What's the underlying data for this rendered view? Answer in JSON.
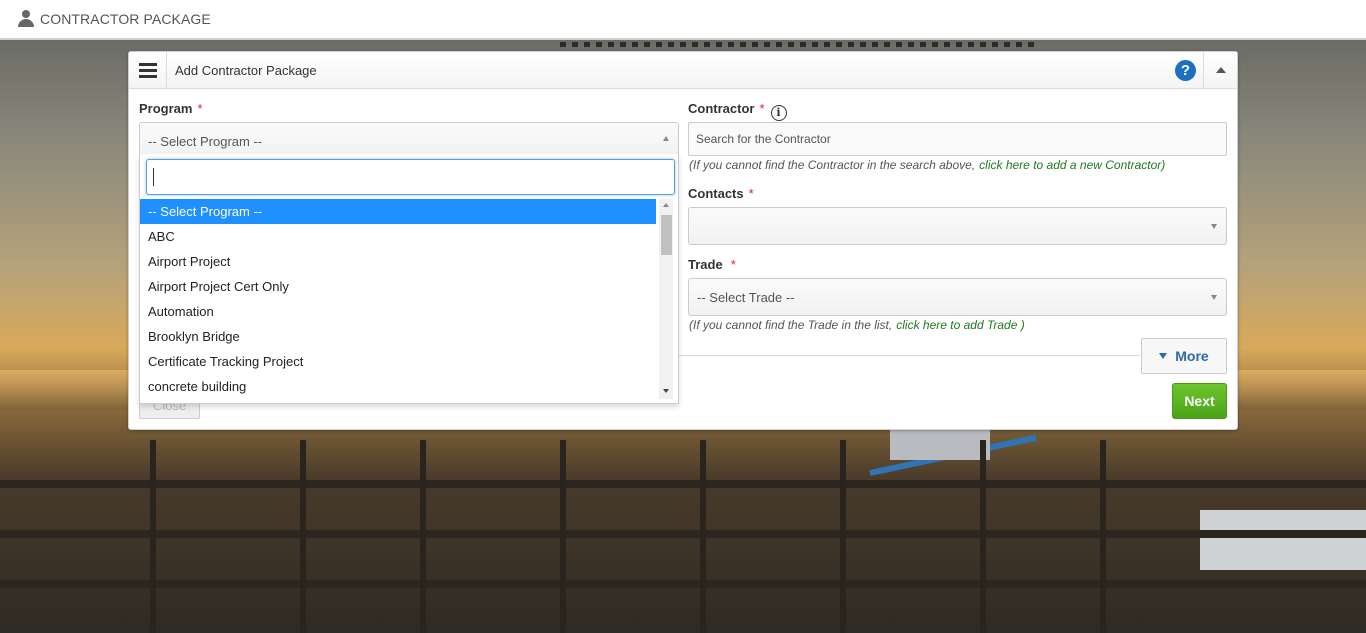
{
  "header": {
    "title": "CONTRACTOR PACKAGE"
  },
  "panel": {
    "title": "Add Contractor Package",
    "help_glyph": "?"
  },
  "program": {
    "label": "Program",
    "required_mark": "*",
    "selected": "-- Select Program --",
    "search_value": "",
    "options": [
      "-- Select Program --",
      "ABC",
      "Airport Project",
      "Airport Project Cert Only",
      "Automation",
      "Brooklyn Bridge",
      "Certificate Tracking Project",
      "concrete building"
    ],
    "highlighted_index": 0
  },
  "contractor": {
    "label": "Contractor",
    "required_mark": "*",
    "info_glyph": "i",
    "placeholder": "Search for the Contractor",
    "hint_text": "(If you cannot find the Contractor in the search above,",
    "hint_link": "click here to add a new Contractor)"
  },
  "contacts": {
    "label": "Contacts",
    "required_mark": "*",
    "value": ""
  },
  "trade": {
    "label": "Trade",
    "required_mark": "*",
    "selected": "-- Select Trade --",
    "hint_text": "(If you cannot find the Trade in the list,",
    "hint_link": "click here to add Trade )"
  },
  "buttons": {
    "more": "More",
    "next": "Next",
    "close": "Close"
  },
  "colors": {
    "accent_blue": "#1e90ff",
    "next_green": "#5ab522",
    "link_green": "#1f7a1f",
    "required_red": "#d9232d"
  },
  "icons": [
    "user-icon",
    "menu-icon",
    "help-icon",
    "collapse-up-icon",
    "info-icon",
    "caret-down-icon",
    "chevron-down-icon"
  ]
}
